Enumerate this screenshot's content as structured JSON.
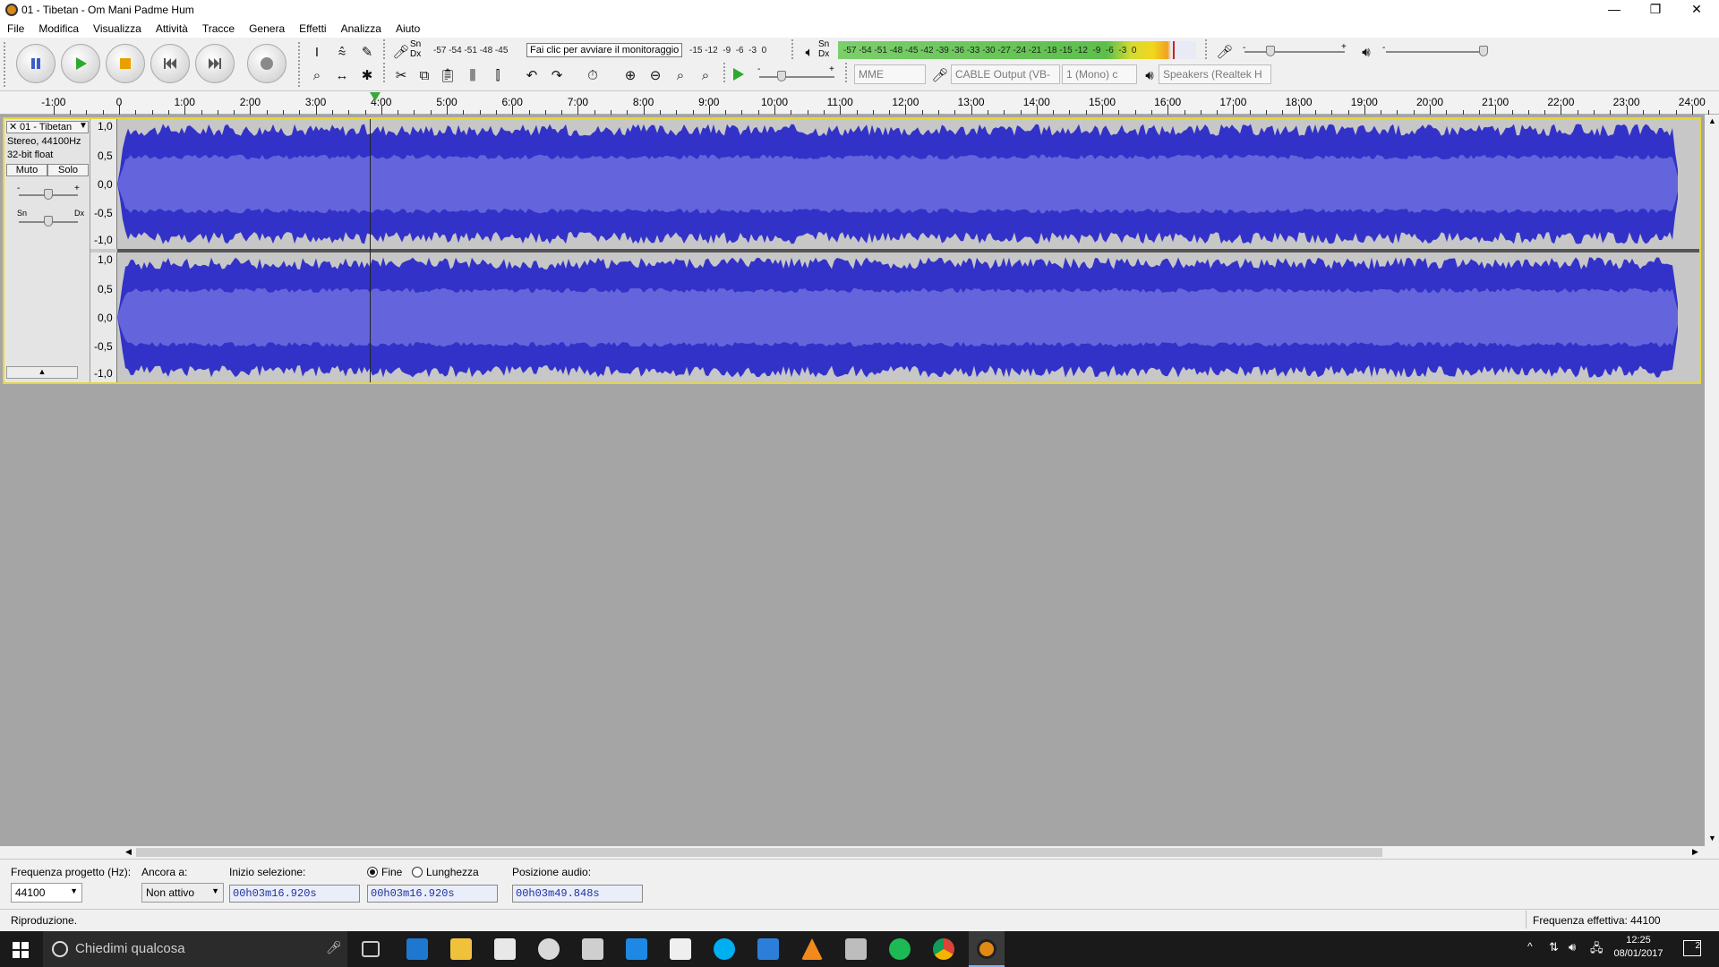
{
  "window": {
    "title": "01 - Tibetan - Om Mani Padme Hum",
    "controls": [
      "—",
      "❐",
      "✕"
    ]
  },
  "menu": [
    "File",
    "Modifica",
    "Visualizza",
    "Attività",
    "Tracce",
    "Genera",
    "Effetti",
    "Analizza",
    "Aiuto"
  ],
  "toolbar": {
    "rec_meter_lr": [
      "Sn",
      "Dx"
    ],
    "rec_meter_ticks": "-57 -54 -51 -48 -45",
    "rec_meter_ticks_right": "-15 -12  -9  -6  -3  0",
    "rec_meter_tooltip": "Fai clic per avviare il monitoraggio",
    "play_meter_lr": [
      "Sn",
      "Dx"
    ],
    "play_meter_ticks": "-57 -54 -51 -48 -45 -42 -39 -36 -33 -30 -27 -24 -21 -18 -15 -12  -9  -6  -3  0",
    "slider_minus": "-",
    "slider_plus": "+",
    "host": "MME",
    "recording_device": "CABLE Output (VB-",
    "channels": "1 (Mono) c",
    "playback_device": "Speakers (Realtek H"
  },
  "ruler": {
    "labels": [
      "-1:00",
      "0",
      "1:00",
      "2:00",
      "3:00",
      "4:00",
      "5:00",
      "6:00",
      "7:00",
      "8:00",
      "9:00",
      "10:00",
      "11:00",
      "12:00",
      "13:00",
      "14:00",
      "15:00",
      "16:00",
      "17:00",
      "18:00",
      "19:00",
      "20:00",
      "21:00",
      "22:00",
      "23:00",
      "24:00"
    ]
  },
  "track": {
    "name": "01 - Tibetan",
    "format": "Stereo, 44100Hz",
    "bits": "32-bit float",
    "mute_label": "Muto",
    "solo_label": "Solo",
    "gain_minus": "-",
    "gain_plus": "+",
    "pan_left": "Sn",
    "pan_right": "Dx",
    "vruler": [
      "1,0",
      "0,5",
      "0,0",
      "-0,5",
      "-1,0"
    ]
  },
  "selection_bar": {
    "rate_label": "Frequenza progetto (Hz):",
    "rate_value": "44100",
    "snap_label": "Ancora a:",
    "snap_value": "Non attivo",
    "start_label": "Inizio selezione:",
    "start_value": "00h03m16.920s",
    "end_option": "Fine",
    "length_option": "Lunghezza",
    "end_value": "00h03m16.920s",
    "audio_pos_label": "Posizione audio:",
    "audio_pos_value": "00h03m49.848s"
  },
  "status": {
    "left": "Riproduzione.",
    "right": "Frequenza effettiva: 44100"
  },
  "taskbar": {
    "search_placeholder": "Chiedimi qualcosa",
    "time": "12:25",
    "date": "08/01/2017",
    "notifications": "2"
  },
  "colors": {
    "waveform_outer": "#3232c8",
    "waveform_rms": "#6464dc",
    "track_bg": "#c7c7c7",
    "selection_border": "#e6d63a"
  }
}
